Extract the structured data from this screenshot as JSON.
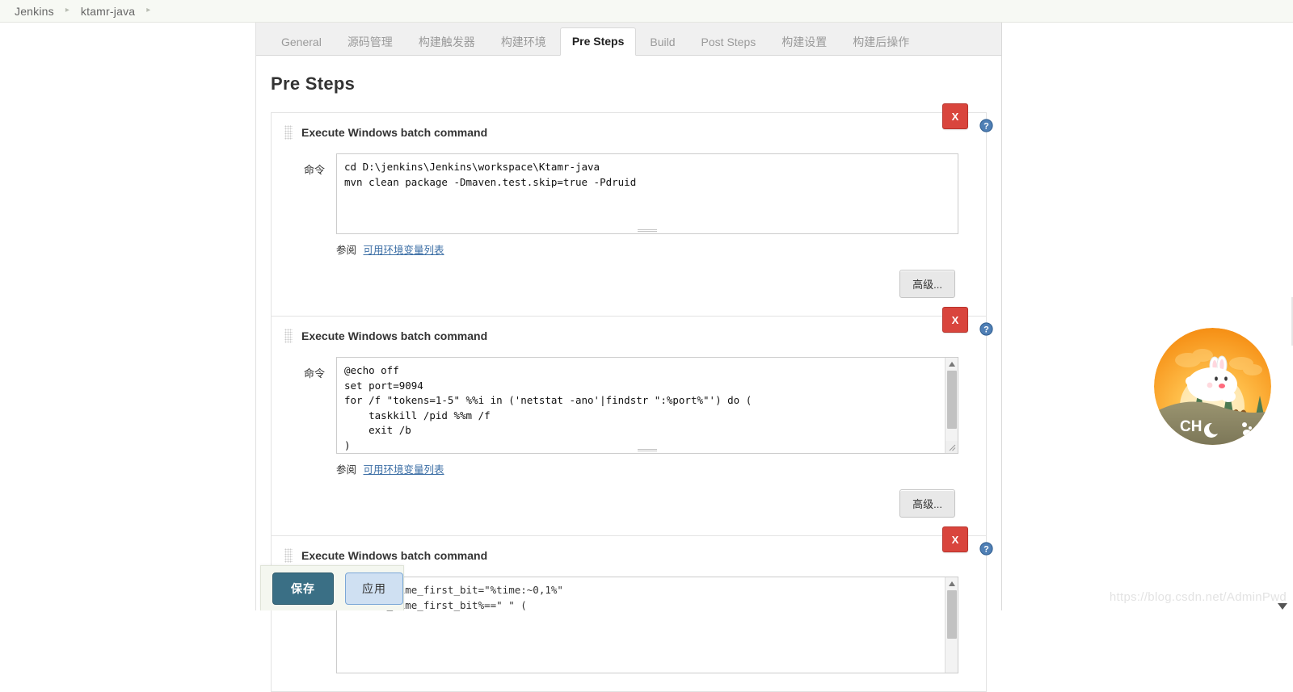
{
  "breadcrumb": {
    "items": [
      {
        "label": "Jenkins"
      },
      {
        "label": "ktamr-java"
      }
    ],
    "separator": "▸"
  },
  "tabs": [
    {
      "label": "General",
      "active": false
    },
    {
      "label": "源码管理",
      "active": false
    },
    {
      "label": "构建触发器",
      "active": false
    },
    {
      "label": "构建环境",
      "active": false
    },
    {
      "label": "Pre Steps",
      "active": true
    },
    {
      "label": "Build",
      "active": false
    },
    {
      "label": "Post Steps",
      "active": false
    },
    {
      "label": "构建设置",
      "active": false
    },
    {
      "label": "构建后操作",
      "active": false
    }
  ],
  "page": {
    "title": "Pre Steps"
  },
  "common": {
    "builder_title": "Execute Windows batch command",
    "command_label": "命令",
    "ref_prefix": "参阅",
    "ref_link": "可用环境变量列表",
    "advanced_label": "高级...",
    "delete_label": "X",
    "help_label": "?"
  },
  "builders": [
    {
      "title": "Execute Windows batch command",
      "command": "cd D:\\jenkins\\Jenkins\\workspace\\Ktamr-java\nmvn clean package -Dmaven.test.skip=true -Pdruid",
      "has_scrollbar": false
    },
    {
      "title": "Execute Windows batch command",
      "command": "@echo off\nset port=9094\nfor /f \"tokens=1-5\" %%i in ('netstat -ano'|findstr \":%port%\"') do (\n    taskkill /pid %%m /f\n    exit /b\n)",
      "has_scrollbar": true
    },
    {
      "title": "Execute Windows batch command",
      "command": "set str_time_first_bit=\"%time:~0,1%\"\nif %str_time_first_bit%==\" \" (",
      "has_scrollbar": true
    }
  ],
  "savebar": {
    "save_label": "保存",
    "apply_label": "应用"
  },
  "watermark": {
    "text": "https://blog.csdn.net/AdminPwd"
  },
  "mascot": {
    "caption": "CH"
  },
  "colors": {
    "accent_delete": "#d9453d",
    "accent_save": "#3a6f85",
    "accent_apply": "#cfe0f2",
    "link": "#3b6ea5",
    "breadcrumb_bg": "#f7f9f4"
  }
}
